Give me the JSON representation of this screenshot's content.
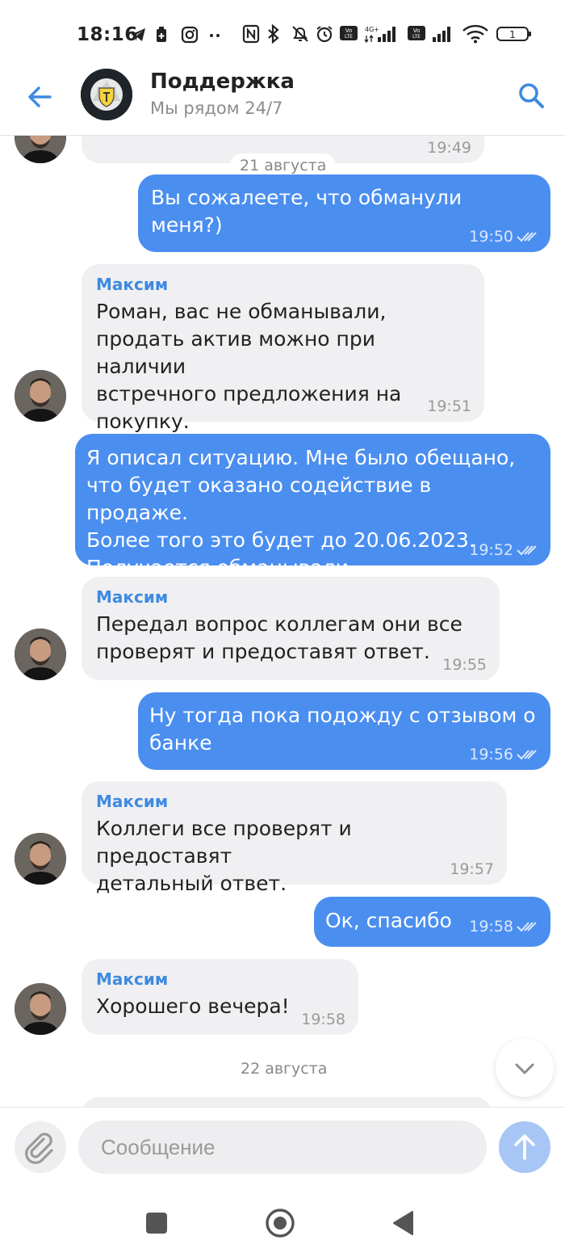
{
  "status_bar": {
    "time": "18:16",
    "network": "4G+",
    "volte": "Vo LTE",
    "battery": "1"
  },
  "header": {
    "title": "Поддержка",
    "subtitle": "Мы рядом 24/7"
  },
  "chat": {
    "partial_top_time": "19:49",
    "date_1": "21 августа",
    "date_2": "22 августа",
    "messages": [
      {
        "dir": "out",
        "text": "Вы сожалеете, что обманули меня?)",
        "time": "19:50"
      },
      {
        "dir": "in",
        "sender": "Максим",
        "text": "Роман, вас не обманывали,\nпродать актив можно при наличии\nвстречного предложения на\nпокупку.",
        "time": "19:51"
      },
      {
        "dir": "out",
        "text": "Я описал ситуацию. Мне было обещано,\nчто будет оказано содействие в продаже.\nБолее того это будет до 20.06.2023.\nПолучается обманывали",
        "time": "19:52"
      },
      {
        "dir": "in",
        "sender": "Максим",
        "text": "Передал вопрос коллегам они все\nпроверят и предоставят ответ.",
        "time": "19:55"
      },
      {
        "dir": "out",
        "text": "Ну тогда пока подожду с отзывом о\nбанке",
        "time": "19:56"
      },
      {
        "dir": "in",
        "sender": "Максим",
        "text": "Коллеги все проверят и предоставят\nдетальный ответ.",
        "time": "19:57"
      },
      {
        "dir": "out",
        "text": "Ок, спасибо",
        "time": "19:58"
      },
      {
        "dir": "in",
        "sender": "Максим",
        "text": "Хорошего вечера!",
        "time": "19:58"
      }
    ]
  },
  "composer": {
    "placeholder": "Сообщение"
  },
  "icons": {
    "back": "arrow-left-icon",
    "search": "search-icon",
    "attach": "paperclip-icon",
    "send": "arrow-up-icon",
    "scroll": "chevron-down-icon",
    "read": "double-check-icon"
  },
  "colors": {
    "accent": "#3f8ae0",
    "outgoing_bubble": "#4a8ef0",
    "incoming_bubble": "#f0f0f2",
    "send_button": "#a7c6f6"
  }
}
